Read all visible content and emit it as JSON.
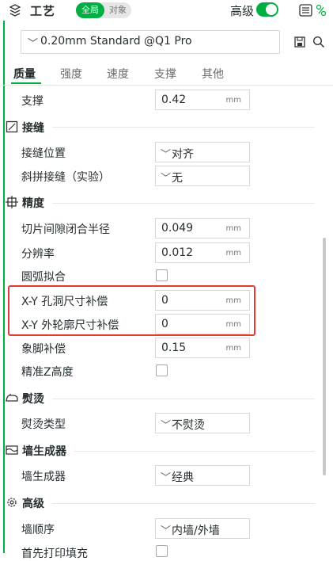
{
  "header": {
    "title": "工艺",
    "seg_global": "全局",
    "seg_object": "对象",
    "advanced_label": "高级",
    "advanced_on": true
  },
  "preset": {
    "value": "0.20mm Standard @Q1 Pro"
  },
  "tabs": [
    "质量",
    "强度",
    "速度",
    "支撑",
    "其他"
  ],
  "rows": {
    "support_label": "支撑",
    "support_value": "0.42",
    "support_unit": "mm",
    "seam_section": "接缝",
    "seam_pos_label": "接缝位置",
    "seam_pos_value": "对齐",
    "scarf_label": "斜拼接缝（实验）",
    "scarf_value": "无",
    "precision_section": "精度",
    "slice_gap_label": "切片间隙闭合半径",
    "slice_gap_value": "0.049",
    "slice_gap_unit": "mm",
    "resolution_label": "分辨率",
    "resolution_value": "0.012",
    "resolution_unit": "mm",
    "arc_label": "圆弧拟合",
    "xy_hole_label": "X-Y 孔洞尺寸补偿",
    "xy_hole_value": "0",
    "xy_hole_unit": "mm",
    "xy_contour_label": "X-Y 外轮廓尺寸补偿",
    "xy_contour_value": "0",
    "xy_contour_unit": "mm",
    "elephant_label": "象脚补偿",
    "elephant_value": "0.15",
    "elephant_unit": "mm",
    "precise_z_label": "精准Z高度",
    "ironing_section": "熨烫",
    "ironing_type_label": "熨烫类型",
    "ironing_type_value": "不熨烫",
    "wall_gen_section": "墙生成器",
    "wall_gen_label": "墙生成器",
    "wall_gen_value": "经典",
    "advanced_section": "高级",
    "wall_order_label": "墙顺序",
    "wall_order_value": "内墙/外墙",
    "first_print_label": "首先打印填充"
  },
  "colors": {
    "accent": "#00ae42",
    "highlight": "#e53935"
  }
}
